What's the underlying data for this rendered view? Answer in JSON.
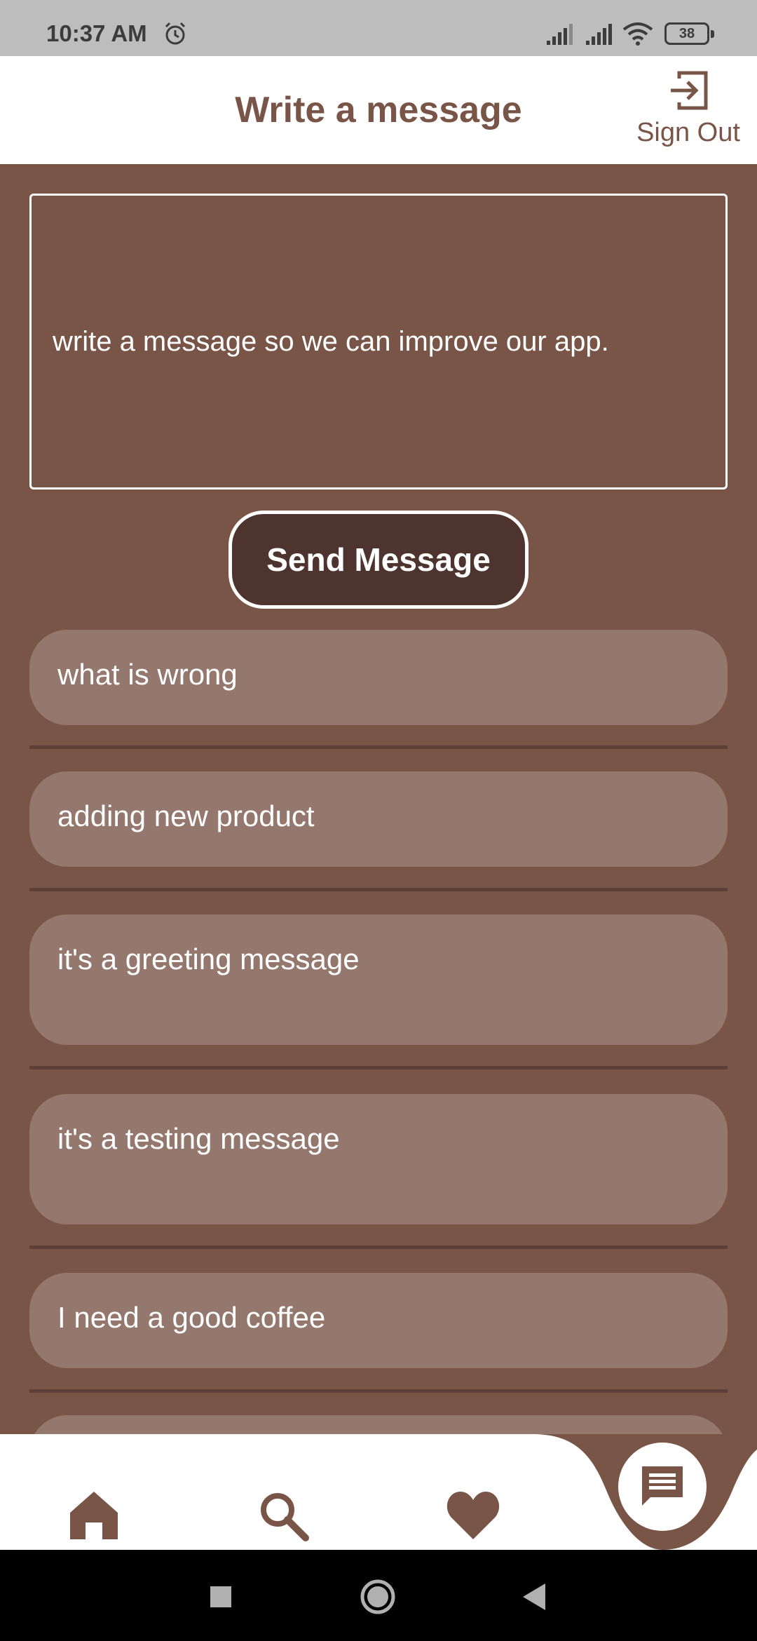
{
  "status_bar": {
    "time": "10:37 AM",
    "battery": "38",
    "icons": [
      "alarm-icon",
      "signal-icon",
      "signal-icon",
      "wifi-icon",
      "battery-icon"
    ]
  },
  "header": {
    "title": "Write a message",
    "sign_out_label": "Sign Out",
    "sign_out_icon": "sign-out-icon"
  },
  "compose": {
    "placeholder": "write a message so we can improve our app.",
    "value": "",
    "send_label": "Send Message"
  },
  "messages": [
    {
      "text": "what is wrong"
    },
    {
      "text": "adding new product"
    },
    {
      "text": "it's a greeting message"
    },
    {
      "text": "it's a testing message"
    },
    {
      "text": "I need a good coffee"
    }
  ],
  "bottom_nav": {
    "items": [
      "home-icon",
      "search-icon",
      "heart-icon",
      "chat-icon"
    ],
    "active": "chat-icon"
  },
  "system_nav": [
    "recents-button",
    "home-button",
    "back-button"
  ],
  "colors": {
    "primary": "#795548",
    "dark": "#4e342e",
    "card": "#95786d",
    "divider": "#5d4037",
    "status_bar": "#bdbdbd"
  }
}
